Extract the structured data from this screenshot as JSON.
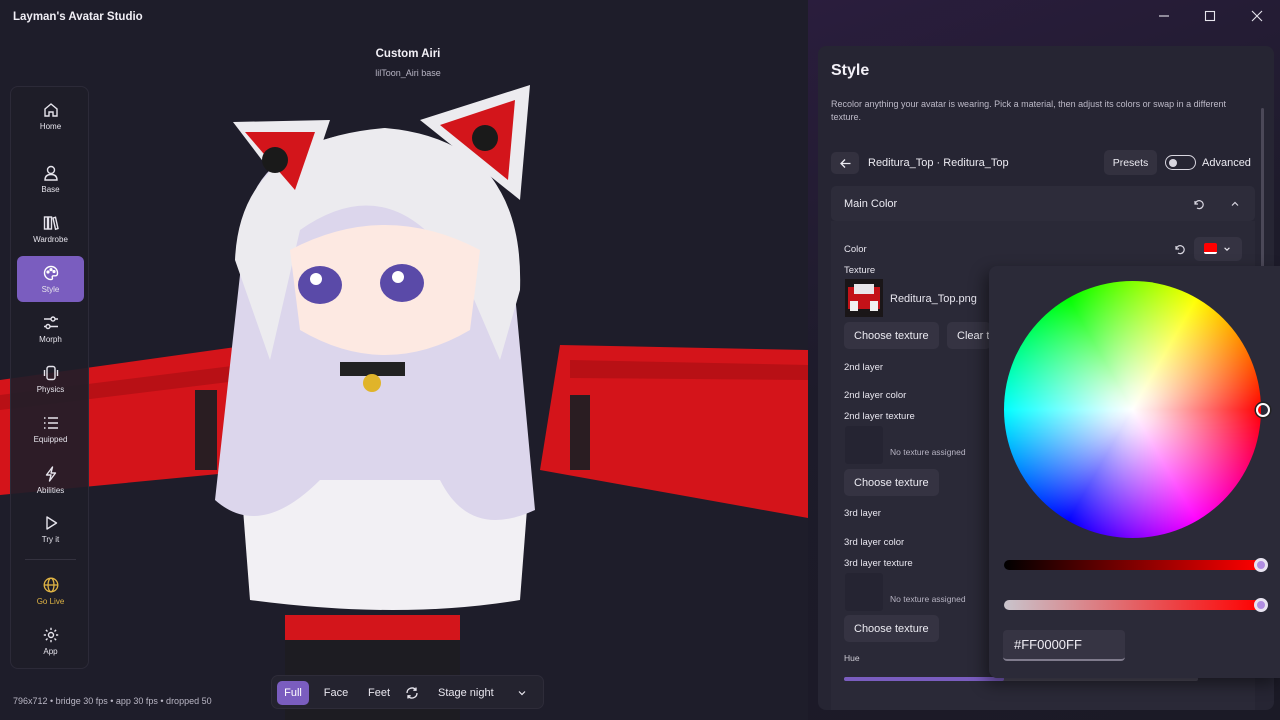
{
  "app_title": "Layman's Avatar Studio",
  "avatar": {
    "name": "Custom Airi",
    "base": "lilToon_Airi base"
  },
  "stats": "796x712 • bridge 30 fps • app 30 fps • dropped 50",
  "nav": {
    "items": [
      {
        "label": "Home",
        "icon": "home-icon"
      },
      {
        "label": "Base",
        "icon": "person-icon"
      },
      {
        "label": "Wardrobe",
        "icon": "books-icon"
      },
      {
        "label": "Style",
        "icon": "palette-icon",
        "active": true
      },
      {
        "label": "Morph",
        "icon": "sliders-icon"
      },
      {
        "label": "Physics",
        "icon": "physics-icon"
      },
      {
        "label": "Equipped",
        "icon": "list-icon"
      },
      {
        "label": "Abilities",
        "icon": "lightning-icon"
      },
      {
        "label": "Try it",
        "icon": "play-icon"
      },
      {
        "label": "Go Live",
        "icon": "globe-icon",
        "accent": "#e0b444"
      },
      {
        "label": "App",
        "icon": "gear-icon"
      }
    ]
  },
  "toolbar": {
    "full": "Full",
    "face": "Face",
    "feet": "Feet",
    "stage": "Stage night",
    "icons": [
      "refresh-icon",
      "chevron-down-icon"
    ]
  },
  "panel": {
    "title": "Style",
    "description": "Recolor anything your avatar is wearing. Pick a material, then adjust its colors or swap in a different texture.",
    "breadcrumb": "Reditura_Top · Reditura_Top",
    "presets": "Presets",
    "advanced_label": "Advanced",
    "advanced_on": false,
    "section": "Main Color",
    "color_label": "Color",
    "texture_label": "Texture",
    "texture_file": "Reditura_Top.png",
    "choose_texture": "Choose texture",
    "clear_texture": "Clear t",
    "layer2": "2nd layer",
    "layer2_color": "2nd layer color",
    "layer2_texture": "2nd layer texture",
    "no_texture": "No texture assigned",
    "layer3": "3rd layer",
    "layer3_color": "3rd layer color",
    "layer3_texture": "3rd layer texture",
    "hue": "Hue"
  },
  "picker": {
    "hex": "#FF0000FF",
    "value_level": 1.0,
    "alpha_level": 1.0
  },
  "colors": {
    "accent": "#7a5dbf",
    "selected_color": "#ff0000",
    "golive": "#e0b444"
  }
}
